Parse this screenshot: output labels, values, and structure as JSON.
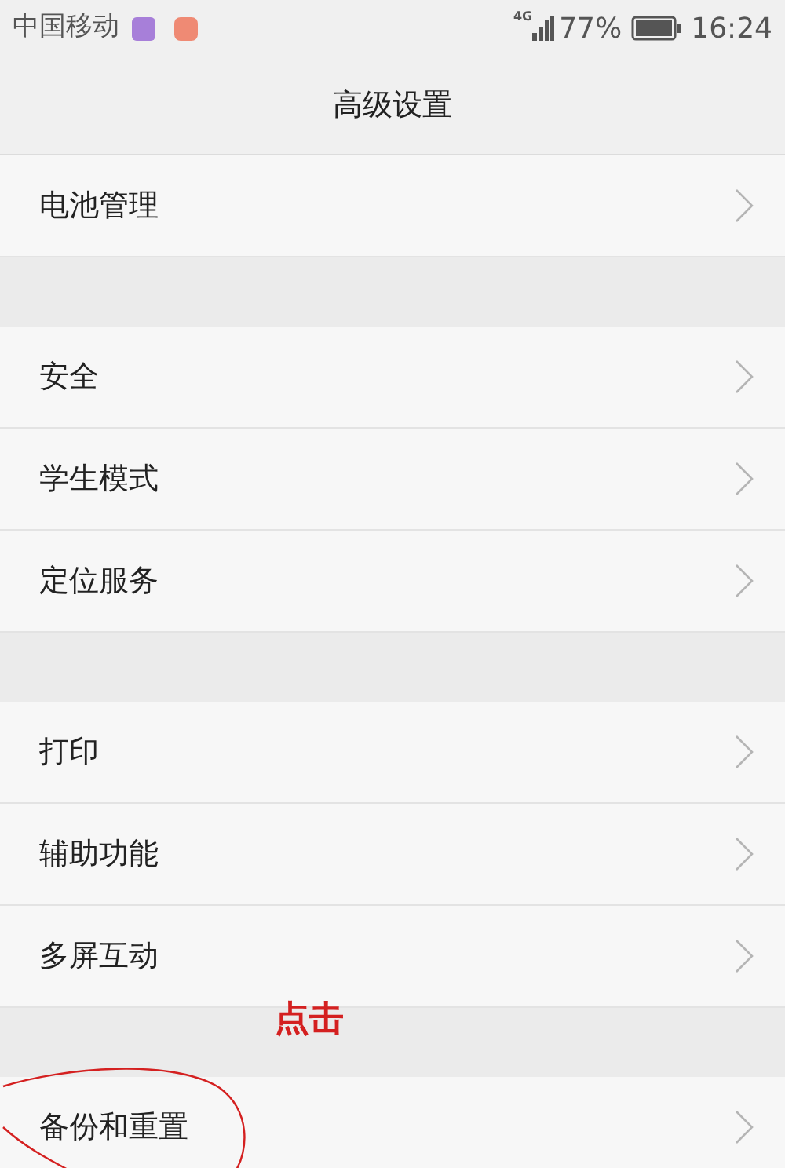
{
  "status_bar": {
    "carrier": "中国移动",
    "network": "4G",
    "battery": "77%",
    "time": "16:24"
  },
  "header": {
    "title": "高级设置"
  },
  "groups": [
    [
      {
        "label": "电池管理"
      }
    ],
    [
      {
        "label": "安全"
      },
      {
        "label": "学生模式"
      },
      {
        "label": "定位服务"
      }
    ],
    [
      {
        "label": "打印"
      },
      {
        "label": "辅助功能"
      },
      {
        "label": "多屏互动"
      }
    ],
    [
      {
        "label": "备份和重置"
      }
    ]
  ],
  "annotation": {
    "text": "点击"
  }
}
